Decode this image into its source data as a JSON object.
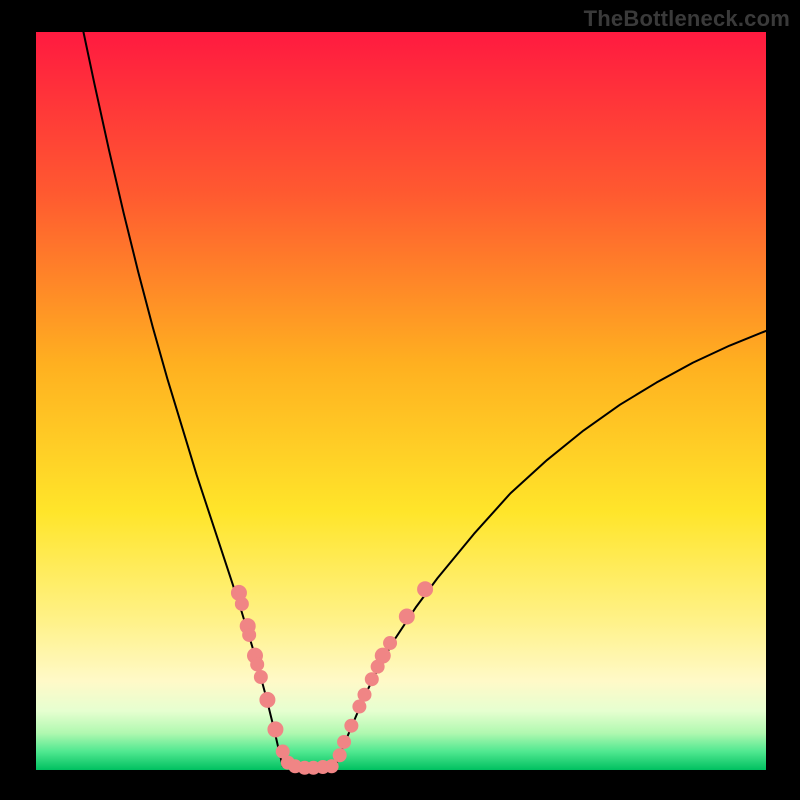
{
  "watermark": "TheBottleneck.com",
  "chart_data": {
    "type": "line",
    "title": "",
    "xlabel": "",
    "ylabel": "",
    "xlim": [
      0,
      100
    ],
    "ylim": [
      0,
      100
    ],
    "grid": false,
    "legend": false,
    "gradient_colors": {
      "top": "#ff1a40",
      "mid_orange": "#ff7a2a",
      "mid_yellow": "#ffe52a",
      "pale_yellow": "#fff9a6",
      "pale_green": "#d6ffc8",
      "green": "#20e070",
      "deep_green": "#00c060"
    },
    "series": [
      {
        "name": "bottleneck-curve-left",
        "x": [
          6.5,
          8,
          10,
          12,
          14,
          16,
          18,
          20,
          22,
          24,
          26,
          28,
          30,
          31.5,
          32.5,
          33.2,
          33.8
        ],
        "y": [
          100,
          93,
          84,
          75.5,
          67.5,
          60,
          53,
          46.5,
          40,
          34,
          28,
          22,
          15.5,
          10,
          6,
          3,
          0.5
        ]
      },
      {
        "name": "bottleneck-curve-flat",
        "x": [
          33.8,
          35,
          36.5,
          38,
          39.5,
          41
        ],
        "y": [
          0.5,
          0.3,
          0.2,
          0.2,
          0.3,
          0.5
        ]
      },
      {
        "name": "bottleneck-curve-right",
        "x": [
          41,
          42,
          43.5,
          45,
          47,
          49,
          52,
          55,
          60,
          65,
          70,
          75,
          80,
          85,
          90,
          95,
          100
        ],
        "y": [
          0.5,
          3,
          6.5,
          10,
          14,
          17.5,
          22,
          26,
          32,
          37.5,
          42,
          46,
          49.5,
          52.5,
          55.2,
          57.5,
          59.5
        ]
      }
    ],
    "markers": {
      "name": "gpu-points",
      "color": "#f08585",
      "radius_large": 8,
      "radius_small": 7,
      "points": [
        {
          "x": 27.8,
          "y": 24.0,
          "r": "large"
        },
        {
          "x": 28.2,
          "y": 22.5,
          "r": "small"
        },
        {
          "x": 29.0,
          "y": 19.5,
          "r": "large"
        },
        {
          "x": 29.2,
          "y": 18.3,
          "r": "small"
        },
        {
          "x": 30.0,
          "y": 15.5,
          "r": "large"
        },
        {
          "x": 30.3,
          "y": 14.3,
          "r": "small"
        },
        {
          "x": 30.8,
          "y": 12.6,
          "r": "small"
        },
        {
          "x": 31.7,
          "y": 9.5,
          "r": "large"
        },
        {
          "x": 32.8,
          "y": 5.5,
          "r": "large"
        },
        {
          "x": 33.8,
          "y": 2.5,
          "r": "small"
        },
        {
          "x": 34.5,
          "y": 1.0,
          "r": "small"
        },
        {
          "x": 35.5,
          "y": 0.5,
          "r": "small"
        },
        {
          "x": 36.8,
          "y": 0.3,
          "r": "small"
        },
        {
          "x": 38.0,
          "y": 0.3,
          "r": "small"
        },
        {
          "x": 39.3,
          "y": 0.4,
          "r": "small"
        },
        {
          "x": 40.5,
          "y": 0.5,
          "r": "small"
        },
        {
          "x": 41.6,
          "y": 2.0,
          "r": "small"
        },
        {
          "x": 42.2,
          "y": 3.8,
          "r": "small"
        },
        {
          "x": 43.2,
          "y": 6.0,
          "r": "small"
        },
        {
          "x": 44.3,
          "y": 8.6,
          "r": "small"
        },
        {
          "x": 45.0,
          "y": 10.2,
          "r": "small"
        },
        {
          "x": 46.0,
          "y": 12.3,
          "r": "small"
        },
        {
          "x": 46.8,
          "y": 14.0,
          "r": "small"
        },
        {
          "x": 47.5,
          "y": 15.5,
          "r": "large"
        },
        {
          "x": 48.5,
          "y": 17.2,
          "r": "small"
        },
        {
          "x": 50.8,
          "y": 20.8,
          "r": "large"
        },
        {
          "x": 53.3,
          "y": 24.5,
          "r": "large"
        }
      ]
    }
  }
}
